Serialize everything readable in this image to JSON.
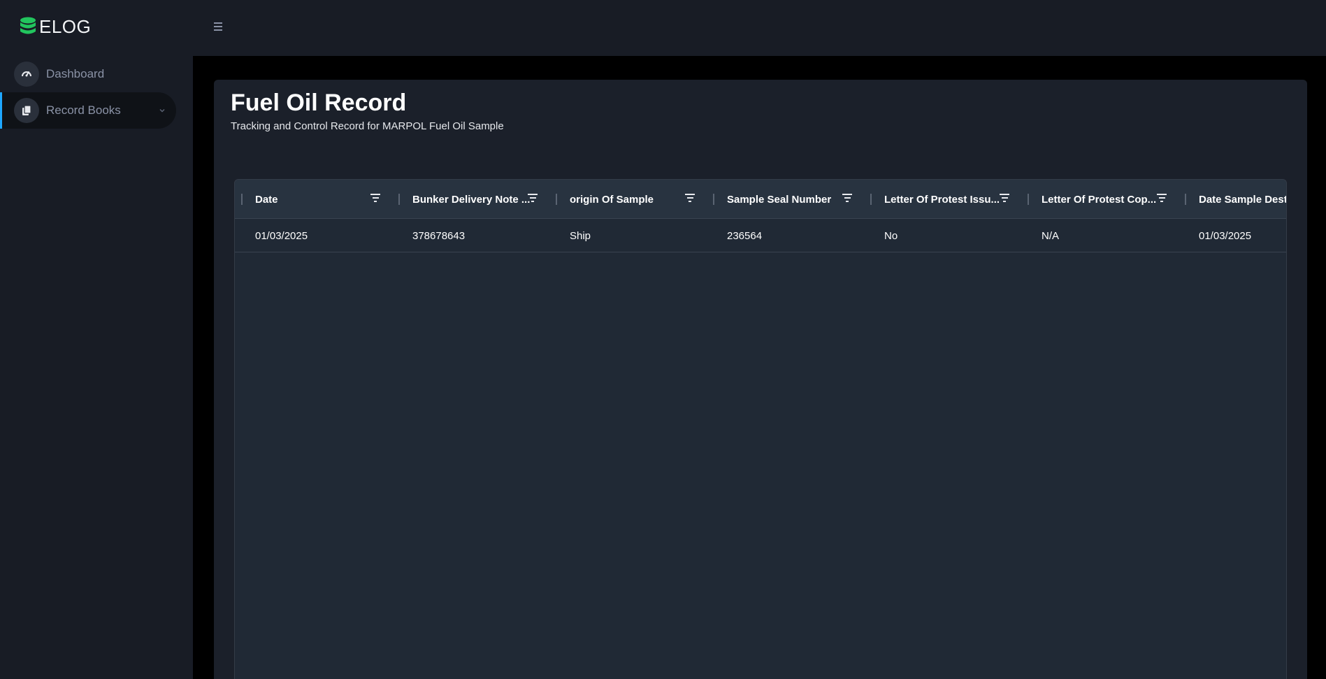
{
  "brand": {
    "name": "ELOG",
    "accent": "#22c55e"
  },
  "sidebar": {
    "items": [
      {
        "label": "Dashboard",
        "icon": "speedometer-icon",
        "active": false
      },
      {
        "label": "Record Books",
        "icon": "books-icon",
        "active": true,
        "expandable": true
      }
    ],
    "active_indicator_color": "#1ea7ff"
  },
  "page": {
    "title": "Fuel Oil Record",
    "subtitle": "Tracking and Control Record for MARPOL Fuel Oil Sample"
  },
  "table": {
    "columns": [
      "Date",
      "Bunker Delivery Note ...",
      "origin Of Sample",
      "Sample Seal Number",
      "Letter Of Protest Issu...",
      "Letter Of Protest Cop...",
      "Date Sample Dest"
    ],
    "rows": [
      [
        "01/03/2025",
        "378678643",
        "Ship",
        "236564",
        "No",
        "N/A",
        "01/03/2025"
      ]
    ]
  }
}
